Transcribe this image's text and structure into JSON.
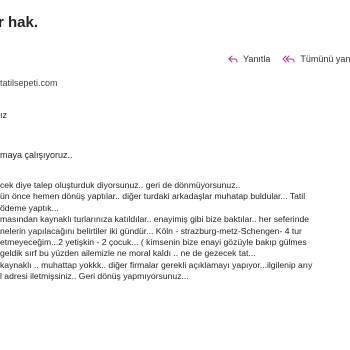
{
  "subject": "r hak.",
  "actions": {
    "reply": "Yanıtla",
    "reply_all": "Tümünü yan"
  },
  "sender_email": "tatilsepeti.com",
  "greeting": "ız",
  "intro": "maya çalışıyoruz..",
  "body_lines": [
    "cek diye talep oluşturduk diyorsunuz.. geri de dönmüyorsunuz..",
    "ün önce hemen dönüş yaptılar.. diğer turdaki arkadaşlar muhatap buldular... Tatil",
    "ödeme yaptık...",
    "masından kaynaklı turlarınıza katıldılar.. enayimiş gibi bize baktılar.. her seferinde",
    "nelerin yapılacağını belirtiler iki gündür... Köln - strazburg-metz-Schengen- 4 tur",
    " etmeyeceğim...2 yetişkin - 2 çocuk... ( kimsenin bize enayi gözüyle bakıp gülmes",
    " geldik sırf bu yüzden ailemizle ne moral kaldı .. ne de gezecek tat...",
    "kaynaklı .. muhattap yokkk.. diğer firmalar gerekli açıklamayı yapıyor...ilgilenip arıy",
    "l adresi iletmişsiniz.. Geri dönüş yapmıyorsunuz..."
  ],
  "colors": {
    "icon_accent": "#b4388a",
    "text": "#242424"
  }
}
